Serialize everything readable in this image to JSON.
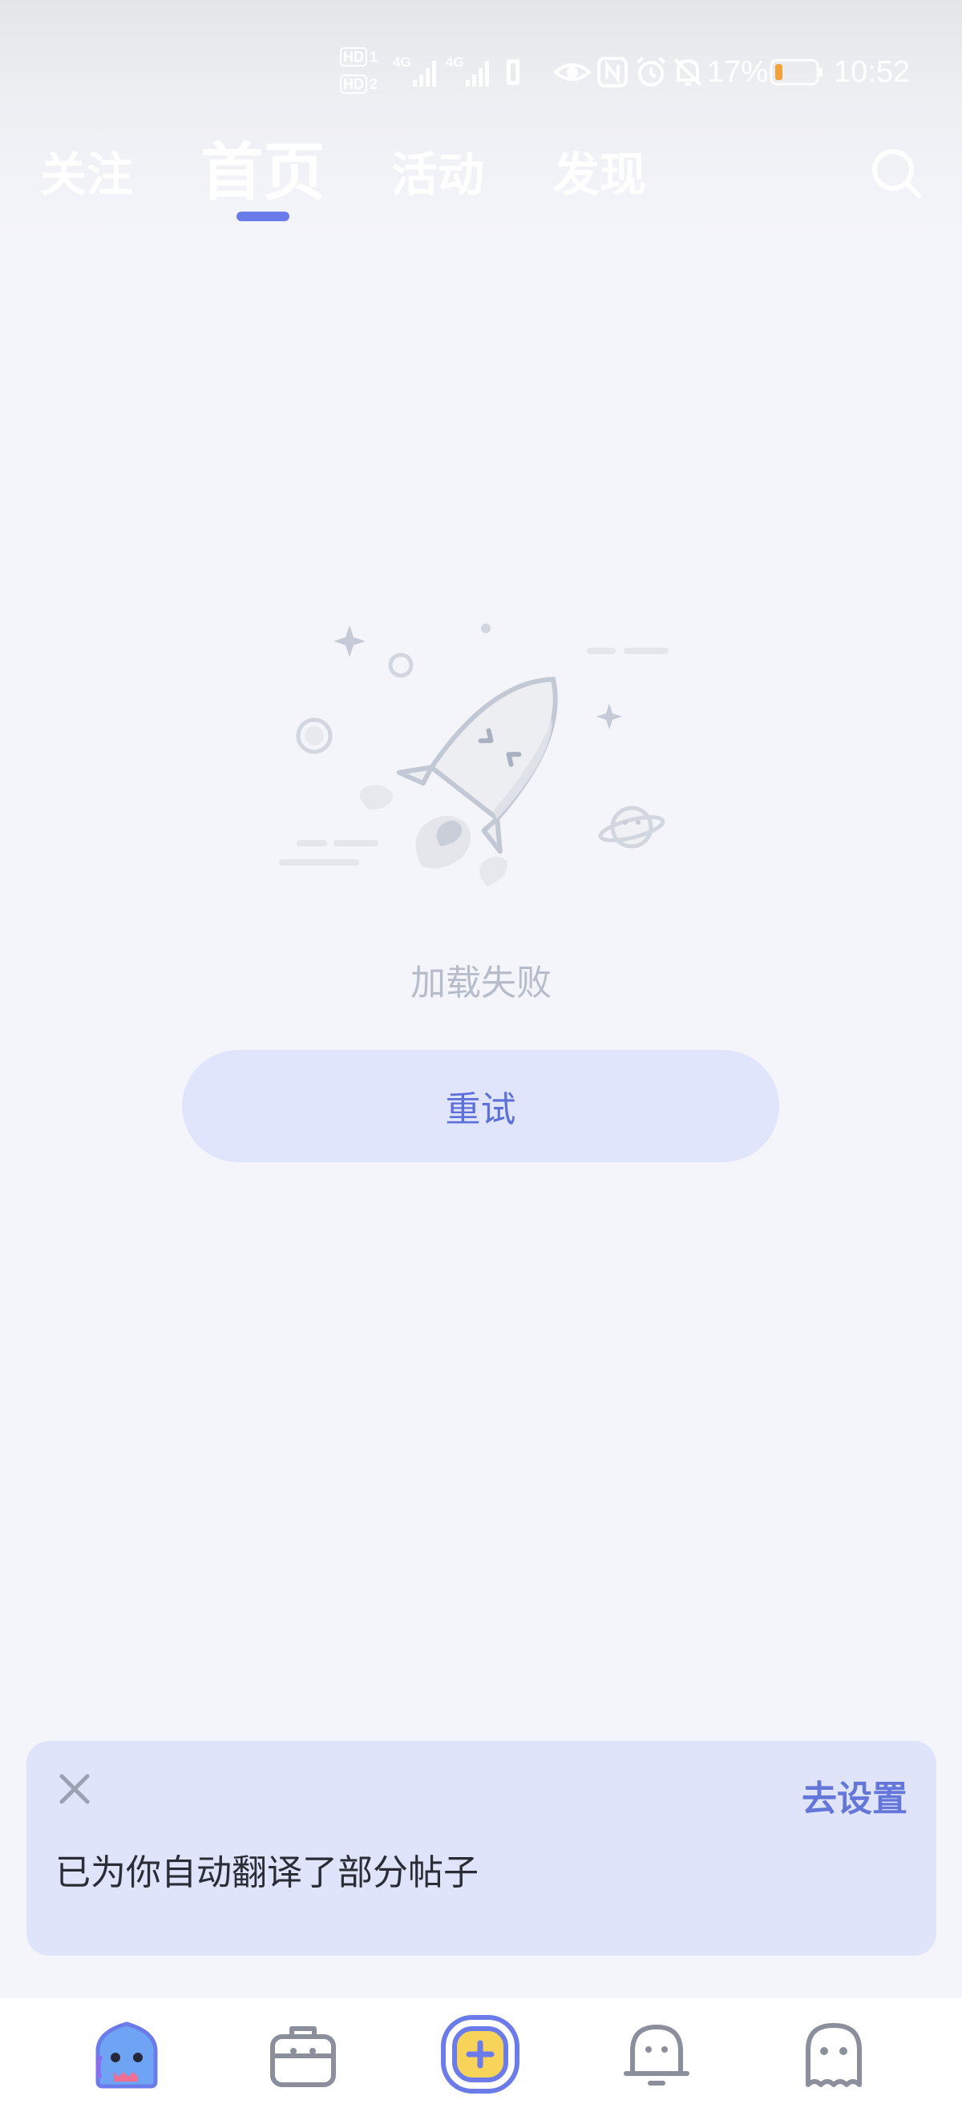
{
  "status_bar": {
    "net_label_1": "HD",
    "net_label_2": "HD",
    "sim_1": "1",
    "sim_2": "2",
    "signal_1_label": "4G",
    "signal_2_label": "4G",
    "battery_percent": "17%",
    "battery_level": 0.17,
    "time": "10:52",
    "icons": [
      "eye-icon",
      "nfc-icon",
      "alarm-icon",
      "mute-bell-icon",
      "battery-icon"
    ]
  },
  "top_tabs": {
    "items": [
      {
        "label": "关注",
        "active": false
      },
      {
        "label": "首页",
        "active": true
      },
      {
        "label": "活动",
        "active": false
      },
      {
        "label": "发现",
        "active": false
      }
    ],
    "search_icon": "search-icon",
    "indicator_color": "#6b7bea"
  },
  "empty_state": {
    "illustration": "rocket-illustration",
    "message": "加载失败",
    "retry_label": "重试"
  },
  "toast": {
    "close_icon": "close-icon",
    "action_label": "去设置",
    "message": "已为你自动翻译了部分帖子"
  },
  "bottom_nav": {
    "items": [
      {
        "name": "home",
        "icon": "monster-home-icon",
        "active": true
      },
      {
        "name": "toolbox",
        "icon": "toolbox-icon",
        "active": false
      },
      {
        "name": "post",
        "icon": "add-post-icon",
        "active": false
      },
      {
        "name": "notifications",
        "icon": "bell-icon",
        "active": false
      },
      {
        "name": "profile",
        "icon": "ghost-profile-icon",
        "active": false
      }
    ]
  },
  "colors": {
    "accent": "#6b7bea",
    "page_bg": "#f4f5fa",
    "toast_bg": "#e0e4fb",
    "retry_bg": "#e0e5fc",
    "fail_text": "#b7bccb",
    "battery_low": "#f2a13b"
  }
}
